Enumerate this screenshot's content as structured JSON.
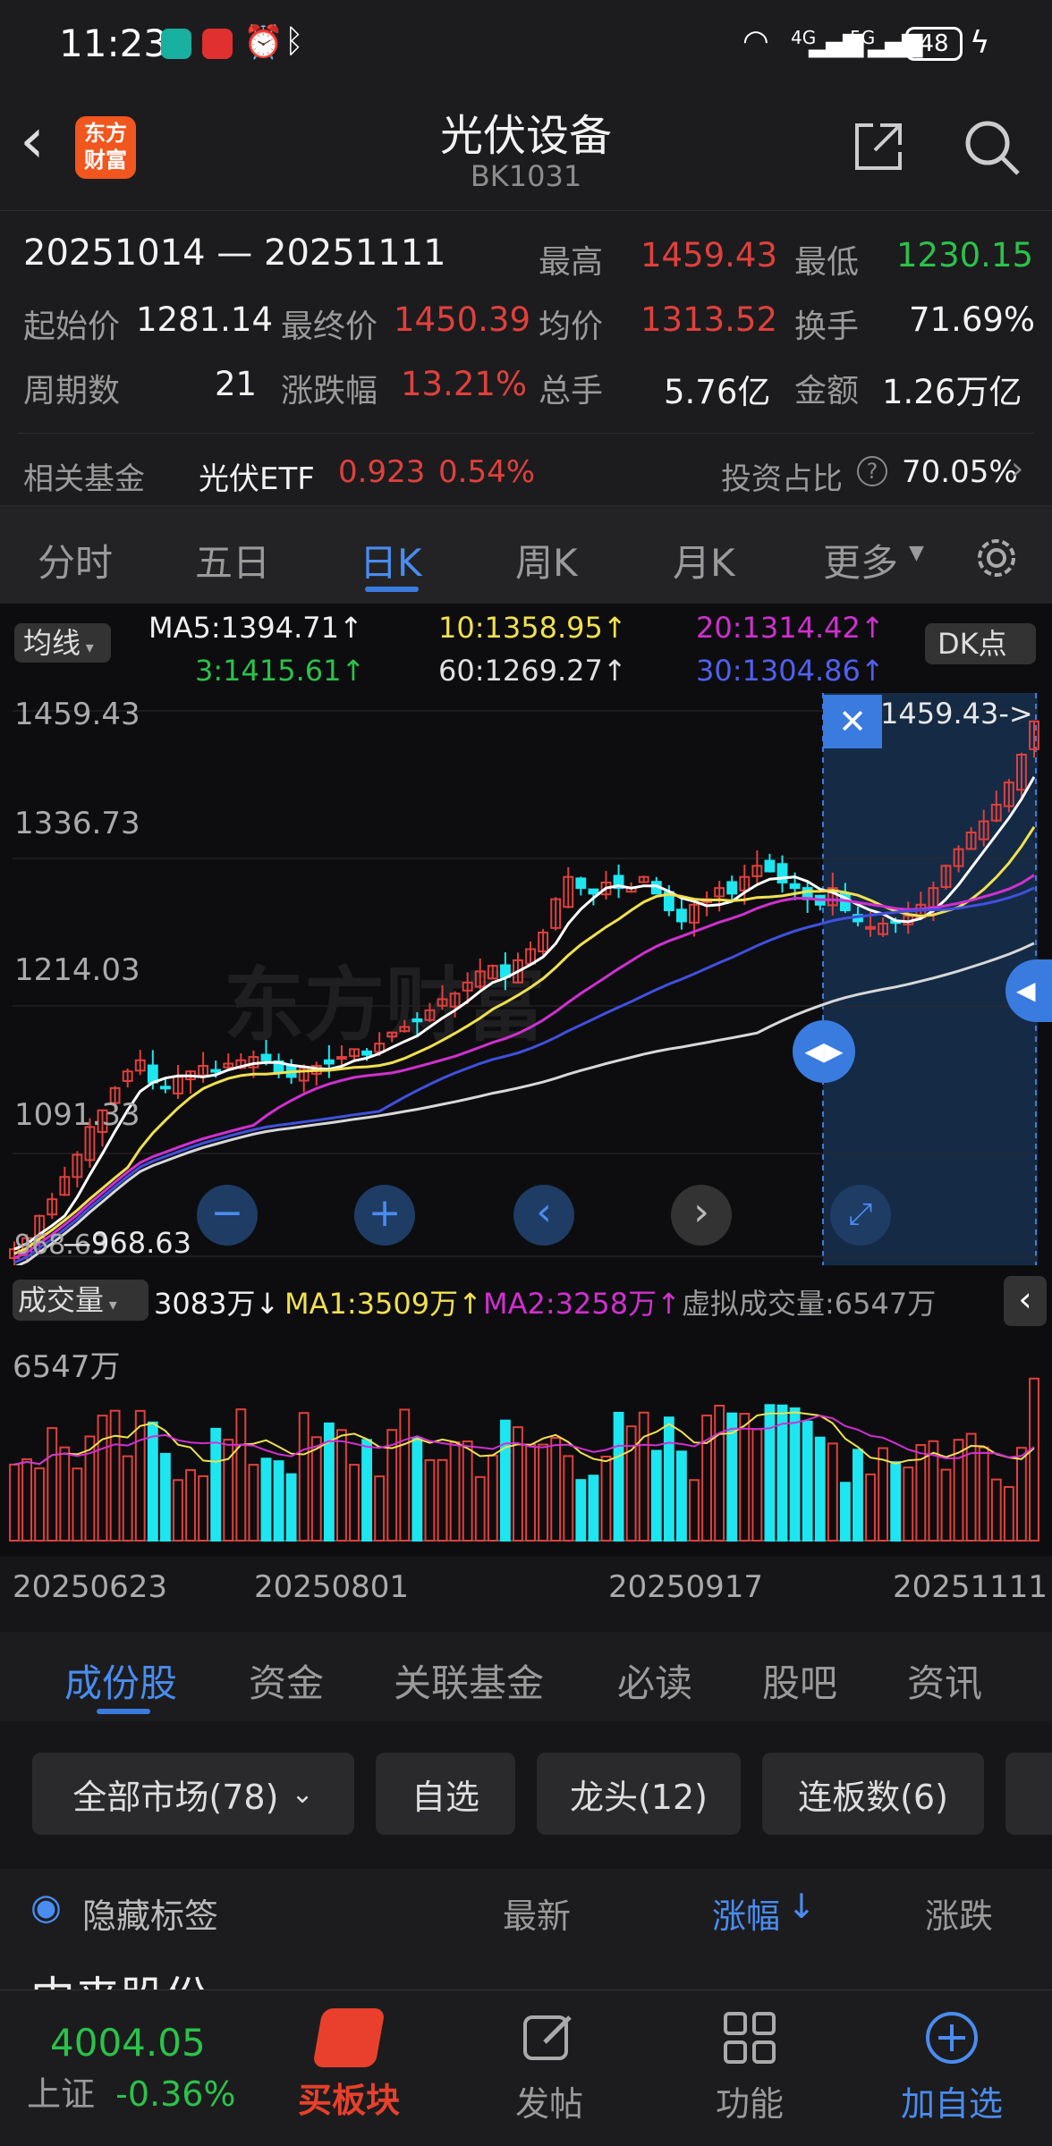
{
  "status_bar": {
    "time": "11:23",
    "signal_4g": "4G",
    "signal_5g": "5G",
    "battery": "48"
  },
  "header": {
    "title": "光伏设备",
    "code": "BK1031",
    "logo_line1": "东方",
    "logo_line2": "财富"
  },
  "summary": {
    "date_range": "20251014 — 20251111",
    "high_label": "最高",
    "high": "1459.43",
    "low_label": "最低",
    "low": "1230.15",
    "open_label": "起始价",
    "open": "1281.14",
    "close_label": "最终价",
    "close": "1450.39",
    "avg_label": "均价",
    "avg": "1313.52",
    "turnover_label": "换手",
    "turnover": "71.69%",
    "periods_label": "周期数",
    "periods": "21",
    "change_label": "涨跌幅",
    "change": "13.21%",
    "total_hands_label": "总手",
    "total_hands": "5.76亿",
    "amount_label": "金额",
    "amount": "1.26万亿",
    "fund_label": "相关基金",
    "fund_name": "光伏ETF",
    "fund_price": "0.923",
    "fund_change": "0.54%",
    "invest_ratio_label": "投资占比",
    "invest_ratio": "70.05%"
  },
  "ktabs": [
    "分时",
    "五日",
    "日K",
    "周K",
    "月K",
    "更多"
  ],
  "ma": {
    "selector": "均线",
    "ma5": "MA5:1394.71↑",
    "ma10": "10:1358.95↑",
    "ma20": "20:1314.42↑",
    "ma3": "3:1415.61↑",
    "ma60": "60:1269.27↑",
    "ma30": "30:1304.86↑",
    "dk": "DK点"
  },
  "chart_labels": {
    "y_ticks": [
      "1459.43",
      "1336.73",
      "1214.03",
      "1091.33",
      "968.63"
    ],
    "max_marker": "1459.43->",
    "min_marker": "968.63"
  },
  "volume": {
    "selector": "成交量",
    "current": "3083万↓",
    "ma1": "MA1:3509万↑",
    "ma2": "MA2:3258万↑",
    "virtual": "虚拟成交量:6547万",
    "max_label": "6547万"
  },
  "x_dates": [
    "20250623",
    "20250801",
    "20250917",
    "20251111"
  ],
  "chart_data": {
    "type": "candlestick",
    "ylim": [
      968.63,
      1459.43
    ],
    "y_ticks": [
      1459.43,
      1336.73,
      1214.03,
      1091.33,
      968.63
    ],
    "x_ticks": [
      "20250623",
      "20250801",
      "20250917",
      "20251111"
    ],
    "highlight_range": [
      "20251014",
      "20251111"
    ],
    "close_trend": [
      975,
      985,
      1005,
      1020,
      1040,
      1060,
      1085,
      1100,
      1120,
      1135,
      1145,
      1125,
      1120,
      1130,
      1135,
      1140,
      1135,
      1142,
      1145,
      1148,
      1145,
      1135,
      1130,
      1138,
      1140,
      1142,
      1148,
      1155,
      1150,
      1160,
      1170,
      1175,
      1180,
      1190,
      1200,
      1205,
      1215,
      1225,
      1230,
      1220,
      1235,
      1245,
      1260,
      1290,
      1310,
      1300,
      1295,
      1305,
      1300,
      1300,
      1310,
      1295,
      1280,
      1270,
      1285,
      1290,
      1300,
      1295,
      1310,
      1320,
      1315,
      1305,
      1300,
      1290,
      1285,
      1300,
      1280,
      1270,
      1265,
      1268,
      1270,
      1275,
      1285,
      1300,
      1320,
      1335,
      1350,
      1360,
      1375,
      1395,
      1420,
      1450
    ],
    "ma_lines": [
      {
        "name": "MA5",
        "color": "#ffffff"
      },
      {
        "name": "MA10",
        "color": "#f0e050"
      },
      {
        "name": "MA20",
        "color": "#d030d0"
      },
      {
        "name": "MA30",
        "color": "#4050e0"
      },
      {
        "name": "MA60",
        "color": "#d8d8d8"
      }
    ],
    "volume_max": "6547万"
  },
  "subtabs": [
    "成份股",
    "资金",
    "关联基金",
    "必读",
    "股吧",
    "资讯"
  ],
  "filters": [
    "全部市场(78)",
    "自选",
    "龙头(12)",
    "连板数(6)"
  ],
  "list_head": {
    "hide_tags": "隐藏标签",
    "latest": "最新",
    "change_pct": "涨幅",
    "change": "涨跌",
    "first_row": "中来股份"
  },
  "navbar": {
    "index_value": "4004.05",
    "index_name": "上证",
    "index_change": "-0.36%",
    "buy_sector": "买板块",
    "post": "发帖",
    "function": "功能",
    "add_watch": "加自选"
  },
  "colors": {
    "up": "#e0403c",
    "down": "#1ee6f0",
    "accent": "#3a7be0",
    "highlight": "#152a45"
  }
}
